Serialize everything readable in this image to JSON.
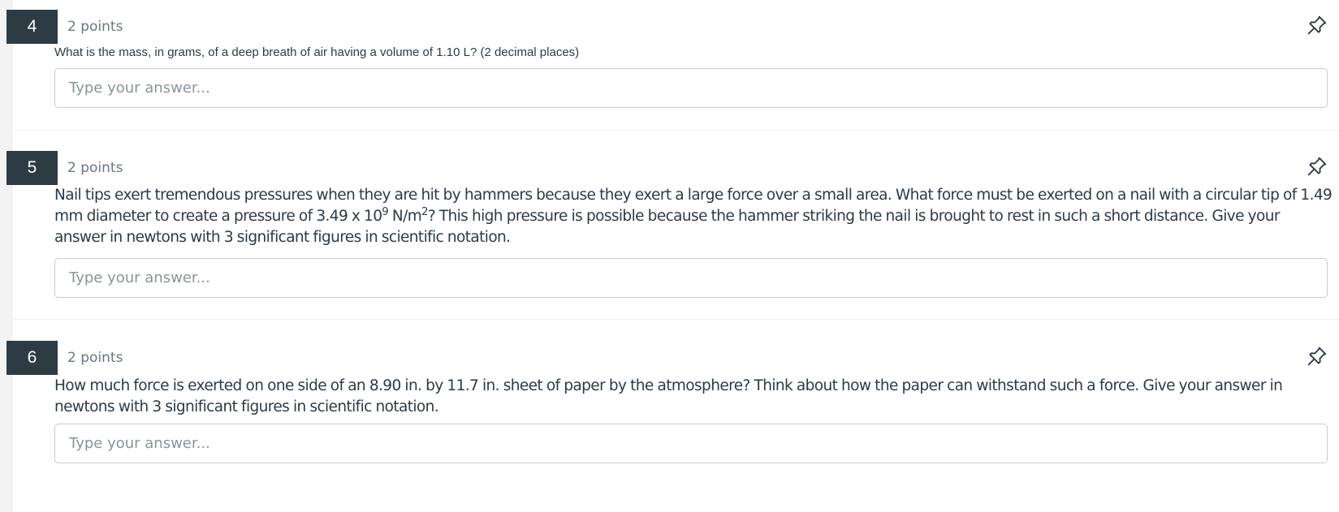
{
  "questions": [
    {
      "number": "4",
      "points": "2 points",
      "text": "What is the mass, in grams, of a deep breath of air having a volume of 1.10 L? (2 decimal places)",
      "answer_value": "",
      "answer_placeholder": "Type your answer..."
    },
    {
      "number": "5",
      "points": "2 points",
      "text_before_exp": "Nail tips exert tremendous pressures when they are hit by hammers because they exert a large force over a small area. What force must be exerted on a nail with a circular tip of 1.49 mm diameter to create a pressure of 3.49 x 10",
      "exp1": "9",
      "text_mid": " N/m",
      "exp2": "2",
      "text_after_exp": "? This high pressure is possible because the hammer striking the nail is brought to rest in such a short distance. Give your answer in newtons with 3 significant figures in scientific notation.",
      "answer_value": "",
      "answer_placeholder": "Type your answer..."
    },
    {
      "number": "6",
      "points": "2 points",
      "text": "How much force is exerted on one side of an 8.90 in. by 11.7 in. sheet of paper by the atmosphere? Think about how the paper can withstand such a force. Give your answer in newtons with 3 significant figures in scientific notation.",
      "answer_value": "",
      "answer_placeholder": "Type your answer..."
    }
  ],
  "icons": {
    "pin": "pin-icon"
  },
  "colors": {
    "number_badge_bg": "#2d3b45",
    "points_text": "#6b7780",
    "question_text": "#2d3b45",
    "input_border": "#c7cdd1",
    "placeholder": "#8a949b"
  }
}
